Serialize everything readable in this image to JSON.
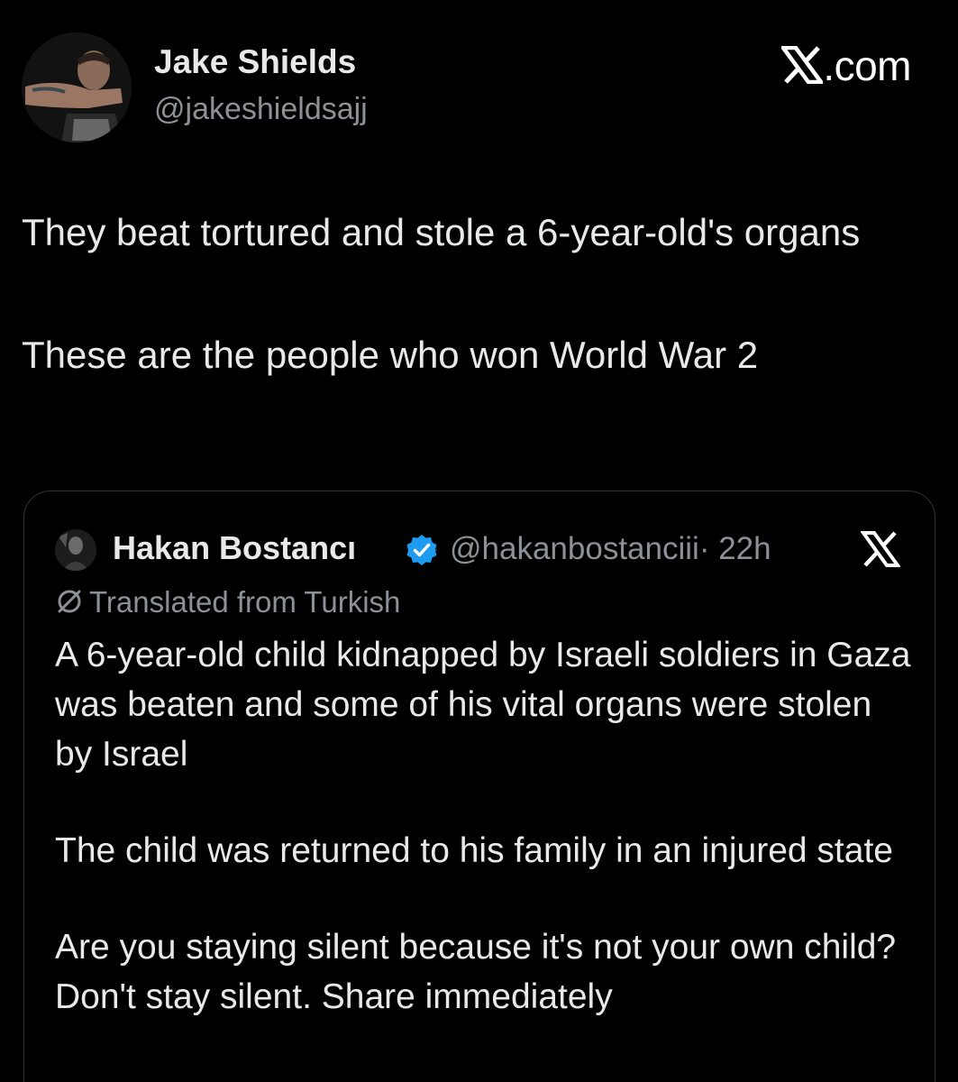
{
  "author": {
    "name": "Jake Shields",
    "handle": "@jakeshieldsajj",
    "avatar": "profile-photo"
  },
  "brand": {
    "label": ".com",
    "icon": "x-logo-icon"
  },
  "tweet": {
    "paragraphs": [
      "They beat tortured and stole a 6-year-old's organs",
      "These are the people who won World War 2"
    ]
  },
  "quote": {
    "name": "Hakan Bostancı",
    "handle": "@hakanbostanciii",
    "time": "· 22h",
    "verified_color": "#1d9bf0",
    "translated_label": "Translated from Turkish",
    "paragraphs": [
      "A 6-year-old child kidnapped by Israeli soldiers in Gaza was beaten and some of his vital organs were stolen by Israel",
      "The child was returned to his family in an injured state",
      "Are you staying silent because it's not your own child? Don't stay silent. Share immediately"
    ]
  }
}
